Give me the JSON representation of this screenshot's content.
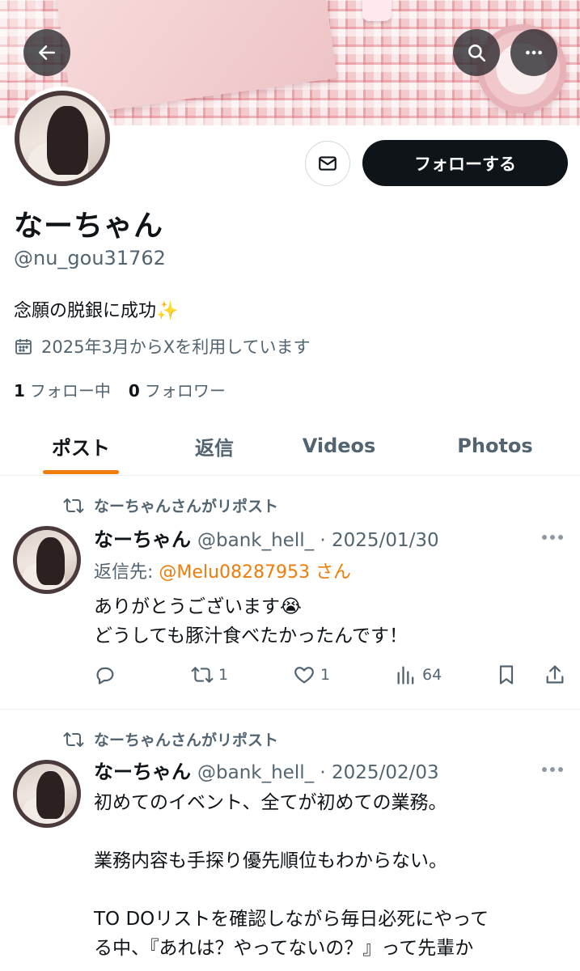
{
  "colors": {
    "accent": "#f07c0a",
    "text": "#0f1419",
    "secondary": "#536471",
    "follow_bg": "#0f1419"
  },
  "icons": {
    "back": "arrow-left-icon",
    "search": "search-icon",
    "more": "more-horizontal-icon",
    "mail": "mail-icon",
    "calendar": "calendar-icon",
    "repost": "repost-icon",
    "reply": "reply-icon",
    "like": "heart-icon",
    "views": "views-icon",
    "bookmark": "bookmark-icon",
    "share": "share-icon"
  },
  "profile": {
    "follow_label": "フォローする",
    "display_name": "なーちゃん",
    "handle": "@nu_gou31762",
    "bio": "念願の脱銀に成功✨",
    "joined": "2025年3月からXを利用しています",
    "following_count": "1",
    "following_label": "フォロー中",
    "followers_count": "0",
    "followers_label": "フォロワー"
  },
  "tabs": [
    {
      "label": "ポスト"
    },
    {
      "label": "返信"
    },
    {
      "label": "Videos"
    },
    {
      "label": "Photos"
    }
  ],
  "posts": [
    {
      "repost_label": "なーちゃんさんがリポスト",
      "name": "なーちゃん",
      "meta": "@bank_hell_ · 2025/01/30",
      "reply_prefix": "返信先: ",
      "reply_mention": "@Melu08287953 さん",
      "lines": [
        "ありがとうございます😭",
        "どうしても豚汁食べたかったんです！"
      ],
      "reposts": "1",
      "likes": "1",
      "views": "64"
    },
    {
      "repost_label": "なーちゃんさんがリポスト",
      "name": "なーちゃん",
      "meta": "@bank_hell_ · 2025/02/03",
      "lines": [
        "初めてのイベント、全てが初めての業務。",
        "",
        "業務内容も手探り優先順位もわからない。",
        "",
        "TO DOリストを確認しながら毎日必死にやって",
        "る中、『あれは？やってないの？』って先輩か"
      ]
    }
  ]
}
